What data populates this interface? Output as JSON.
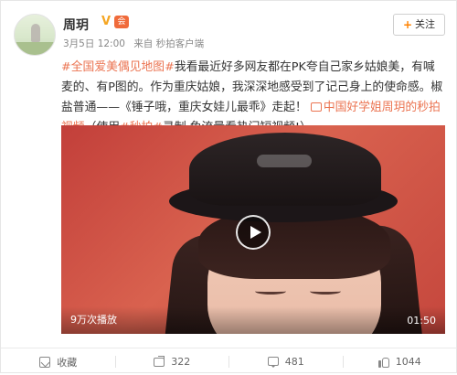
{
  "post": {
    "username": "周玥",
    "verified_icon": "V",
    "vip_icon": "会",
    "meta": {
      "date": "3月5日 12:00",
      "source": "来自 秒拍客户端"
    },
    "follow_label": "关注",
    "topic": "#全国爱美偶见地图#",
    "text_1": "我看最近好多网友都在PK夸自己家乡姑娘美，有喊麦的、有P图的。作为重庆姑娘，我深深地感受到了记己身上的使命感。椒盐普通——《锤子哦，重庆女娃儿最乖》走起！",
    "video_link_label": "中国好学姐周玥的秒拍视频",
    "text_2": "（使用",
    "app_link": "#秒拍#",
    "text_3": "录制,免流量看热门短视频!）"
  },
  "video": {
    "play_count": "9万次播放",
    "duration": "01:50"
  },
  "actions": {
    "collect_label": "收藏",
    "share_count": "322",
    "comment_count": "481",
    "like_count": "1044"
  }
}
